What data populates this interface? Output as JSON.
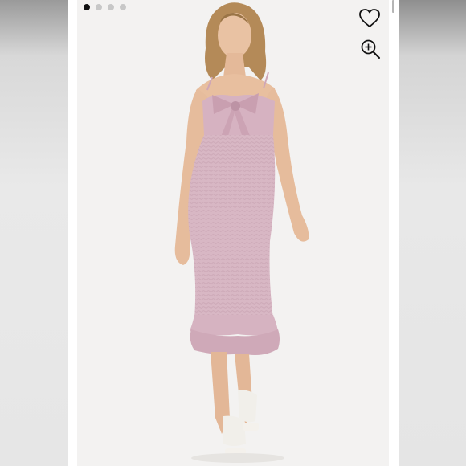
{
  "viewer": {
    "image_count": 4,
    "active_index": 0,
    "accent_color": "#111111",
    "inactive_dot_color": "#c7c7c7",
    "background_color": "#f3f2f1",
    "dress_color": "#d8b7c4"
  },
  "actions": {
    "like_icon": "heart-outline-icon",
    "zoom_icon": "zoom-in-icon"
  }
}
